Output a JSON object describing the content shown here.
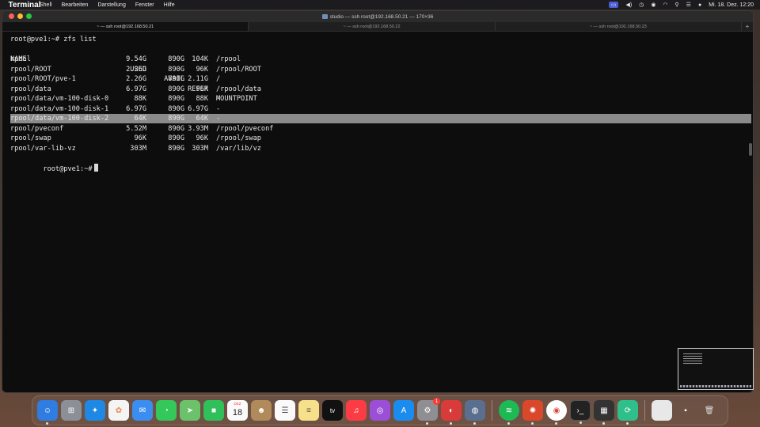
{
  "menubar": {
    "apple": "",
    "items": [
      "Terminal",
      "Shell",
      "Bearbeiten",
      "Darstellung",
      "Fenster",
      "Hilfe"
    ],
    "datetime": "Mi. 18. Dez.  12:20"
  },
  "window": {
    "title": "studio — ssh root@192.168.50.21 — 170×36",
    "tabs": [
      {
        "label": "~ — ssh root@192.168.50.21",
        "active": true
      },
      {
        "label": "~ — ssh root@192.168.50.22",
        "active": false
      },
      {
        "label": "~ — ssh root@192.168.50.23",
        "active": false
      }
    ],
    "new_tab": "+"
  },
  "terminal": {
    "command_line": "root@pve1:~# zfs list",
    "headers": {
      "name": "NAME",
      "used": "USED",
      "avail": "AVAIL",
      "refer": "REFER",
      "mount": "MOUNTPOINT"
    },
    "rows": [
      {
        "name": "rpool",
        "used": "9.54G",
        "avail": "890G",
        "refer": "104K",
        "mount": "/rpool"
      },
      {
        "name": "rpool/ROOT",
        "used": "2.26G",
        "avail": "890G",
        "refer": "96K",
        "mount": "/rpool/ROOT"
      },
      {
        "name": "rpool/ROOT/pve-1",
        "used": "2.26G",
        "avail": "890G",
        "refer": "2.11G",
        "mount": "/"
      },
      {
        "name": "rpool/data",
        "used": "6.97G",
        "avail": "890G",
        "refer": "96K",
        "mount": "/rpool/data"
      },
      {
        "name": "rpool/data/vm-100-disk-0",
        "used": "88K",
        "avail": "890G",
        "refer": "88K",
        "mount": "-"
      },
      {
        "name": "rpool/data/vm-100-disk-1",
        "used": "6.97G",
        "avail": "890G",
        "refer": "6.97G",
        "mount": "-"
      },
      {
        "name": "rpool/data/vm-100-disk-2",
        "used": "64K",
        "avail": "890G",
        "refer": "64K",
        "mount": "-",
        "highlighted": true
      },
      {
        "name": "rpool/pveconf",
        "used": "5.52M",
        "avail": "890G",
        "refer": "3.93M",
        "mount": "/rpool/pveconf"
      },
      {
        "name": "rpool/swap",
        "used": "96K",
        "avail": "890G",
        "refer": "96K",
        "mount": "/rpool/swap"
      },
      {
        "name": "rpool/var-lib-vz",
        "used": "303M",
        "avail": "890G",
        "refer": "303M",
        "mount": "/var/lib/vz"
      }
    ],
    "prompt": "root@pve1:~#"
  },
  "dock": {
    "calendar_month": "DEZ",
    "calendar_day": "18",
    "settings_badge": "1",
    "apps": [
      "finder-icon",
      "launchpad-icon",
      "safari-icon",
      "photos-icon",
      "mail-icon",
      "messages-icon",
      "maps-icon",
      "facetime-icon",
      "calendar-icon",
      "contacts-icon",
      "reminders-icon",
      "notes-icon",
      "appletv-icon",
      "music-icon",
      "podcasts-icon",
      "appstore-icon",
      "settings-icon",
      "app-red-icon",
      "app-globe-icon",
      "spotify-icon",
      "app-orange-icon",
      "chrome-icon",
      "terminal-icon",
      "calculator-icon",
      "app-green-icon"
    ],
    "tv_label": "tv"
  },
  "colors": {
    "menubar": "#1c1c1e",
    "terminal_bg": "#0d0d0d",
    "highlight": "#8a8a8a"
  }
}
